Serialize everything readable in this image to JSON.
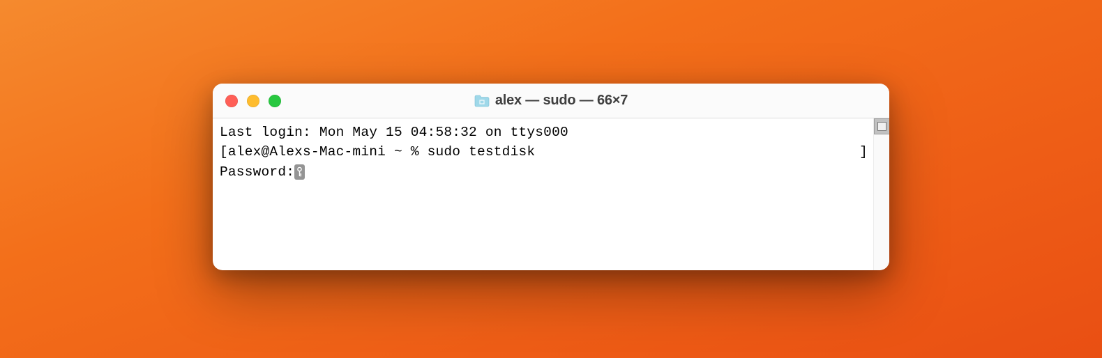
{
  "window": {
    "title": "alex — sudo — 66×7"
  },
  "terminal": {
    "line1": "Last login: Mon May 15 04:58:32 on ttys000",
    "prompt_open": "[",
    "prompt_host": "alex@Alexs-Mac-mini ~ % ",
    "command": "sudo testdisk",
    "prompt_close": "]",
    "password_label": "Password:"
  }
}
